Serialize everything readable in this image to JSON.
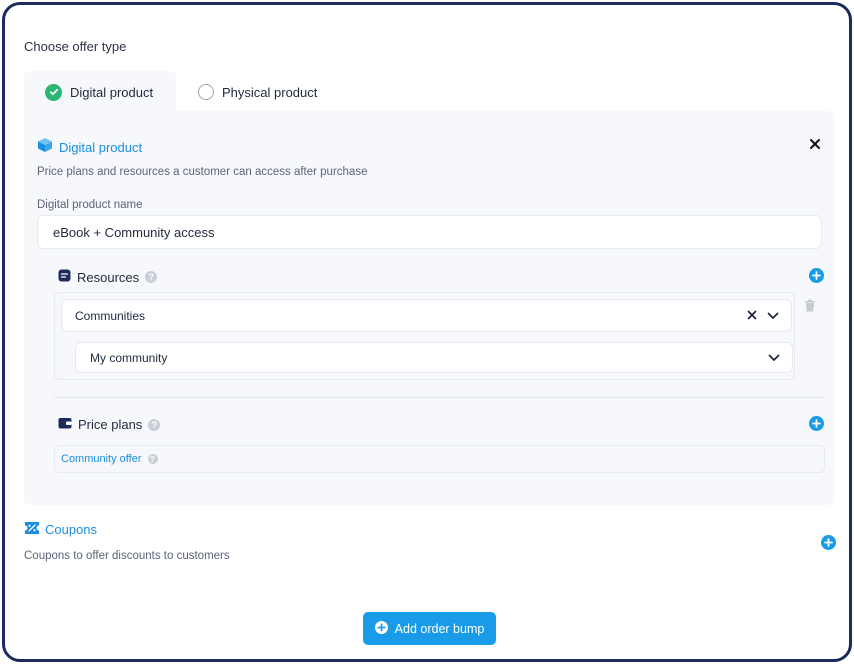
{
  "offer_type": {
    "heading": "Choose offer type",
    "tabs": [
      {
        "label": "Digital product",
        "selected": true
      },
      {
        "label": "Physical product",
        "selected": false
      }
    ]
  },
  "digital_product": {
    "title": "Digital product",
    "description": "Price plans and resources a customer can access after purchase",
    "name_label": "Digital product name",
    "name_value": "eBook + Community access",
    "resources": {
      "label": "Resources",
      "type_value": "Communities",
      "item_value": "My community"
    },
    "price_plans": {
      "label": "Price plans",
      "offer_label": "Community offer"
    }
  },
  "coupons": {
    "title": "Coupons",
    "description": "Coupons to offer discounts to customers"
  },
  "actions": {
    "add_order_bump": "Add order bump"
  },
  "colors": {
    "accent": "#1a9be8",
    "success": "#2bb673",
    "frame": "#1d2b5c"
  }
}
